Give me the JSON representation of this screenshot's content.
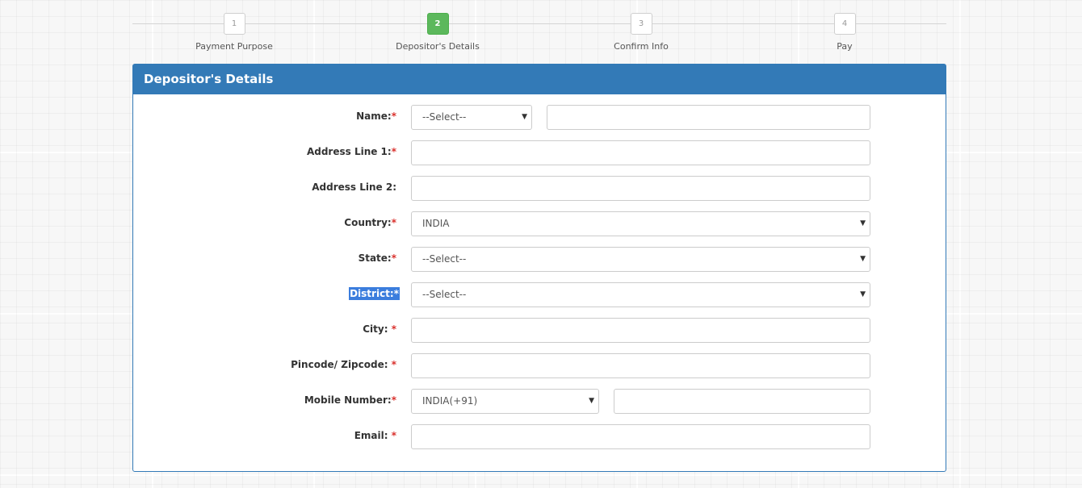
{
  "stepper": {
    "steps": [
      {
        "num": "1",
        "label": "Payment Purpose"
      },
      {
        "num": "2",
        "label": "Depositor's Details"
      },
      {
        "num": "3",
        "label": "Confirm Info"
      },
      {
        "num": "4",
        "label": "Pay"
      }
    ],
    "active_color": "#5cb85c"
  },
  "panel": {
    "title": "Depositor's Details",
    "accent_color": "#337ab7"
  },
  "form": {
    "required_marker": "*",
    "name": {
      "label": "Name:",
      "title_select": "--Select--",
      "value": ""
    },
    "address1": {
      "label": "Address Line 1:",
      "value": ""
    },
    "address2": {
      "label": "Address Line 2:",
      "value": ""
    },
    "country": {
      "label": "Country:",
      "value": "INDIA"
    },
    "state": {
      "label": "State:",
      "value": "--Select--"
    },
    "district": {
      "label": "District:",
      "value": "--Select--"
    },
    "city": {
      "label": "City:",
      "value": ""
    },
    "pincode": {
      "label": "Pincode/ Zipcode:",
      "value": ""
    },
    "mobile": {
      "label": "Mobile Number:",
      "code_select": "INDIA(+91)",
      "value": ""
    },
    "email": {
      "label": "Email:",
      "value": ""
    }
  },
  "icons": {
    "dropdown": "caret-down-icon"
  }
}
